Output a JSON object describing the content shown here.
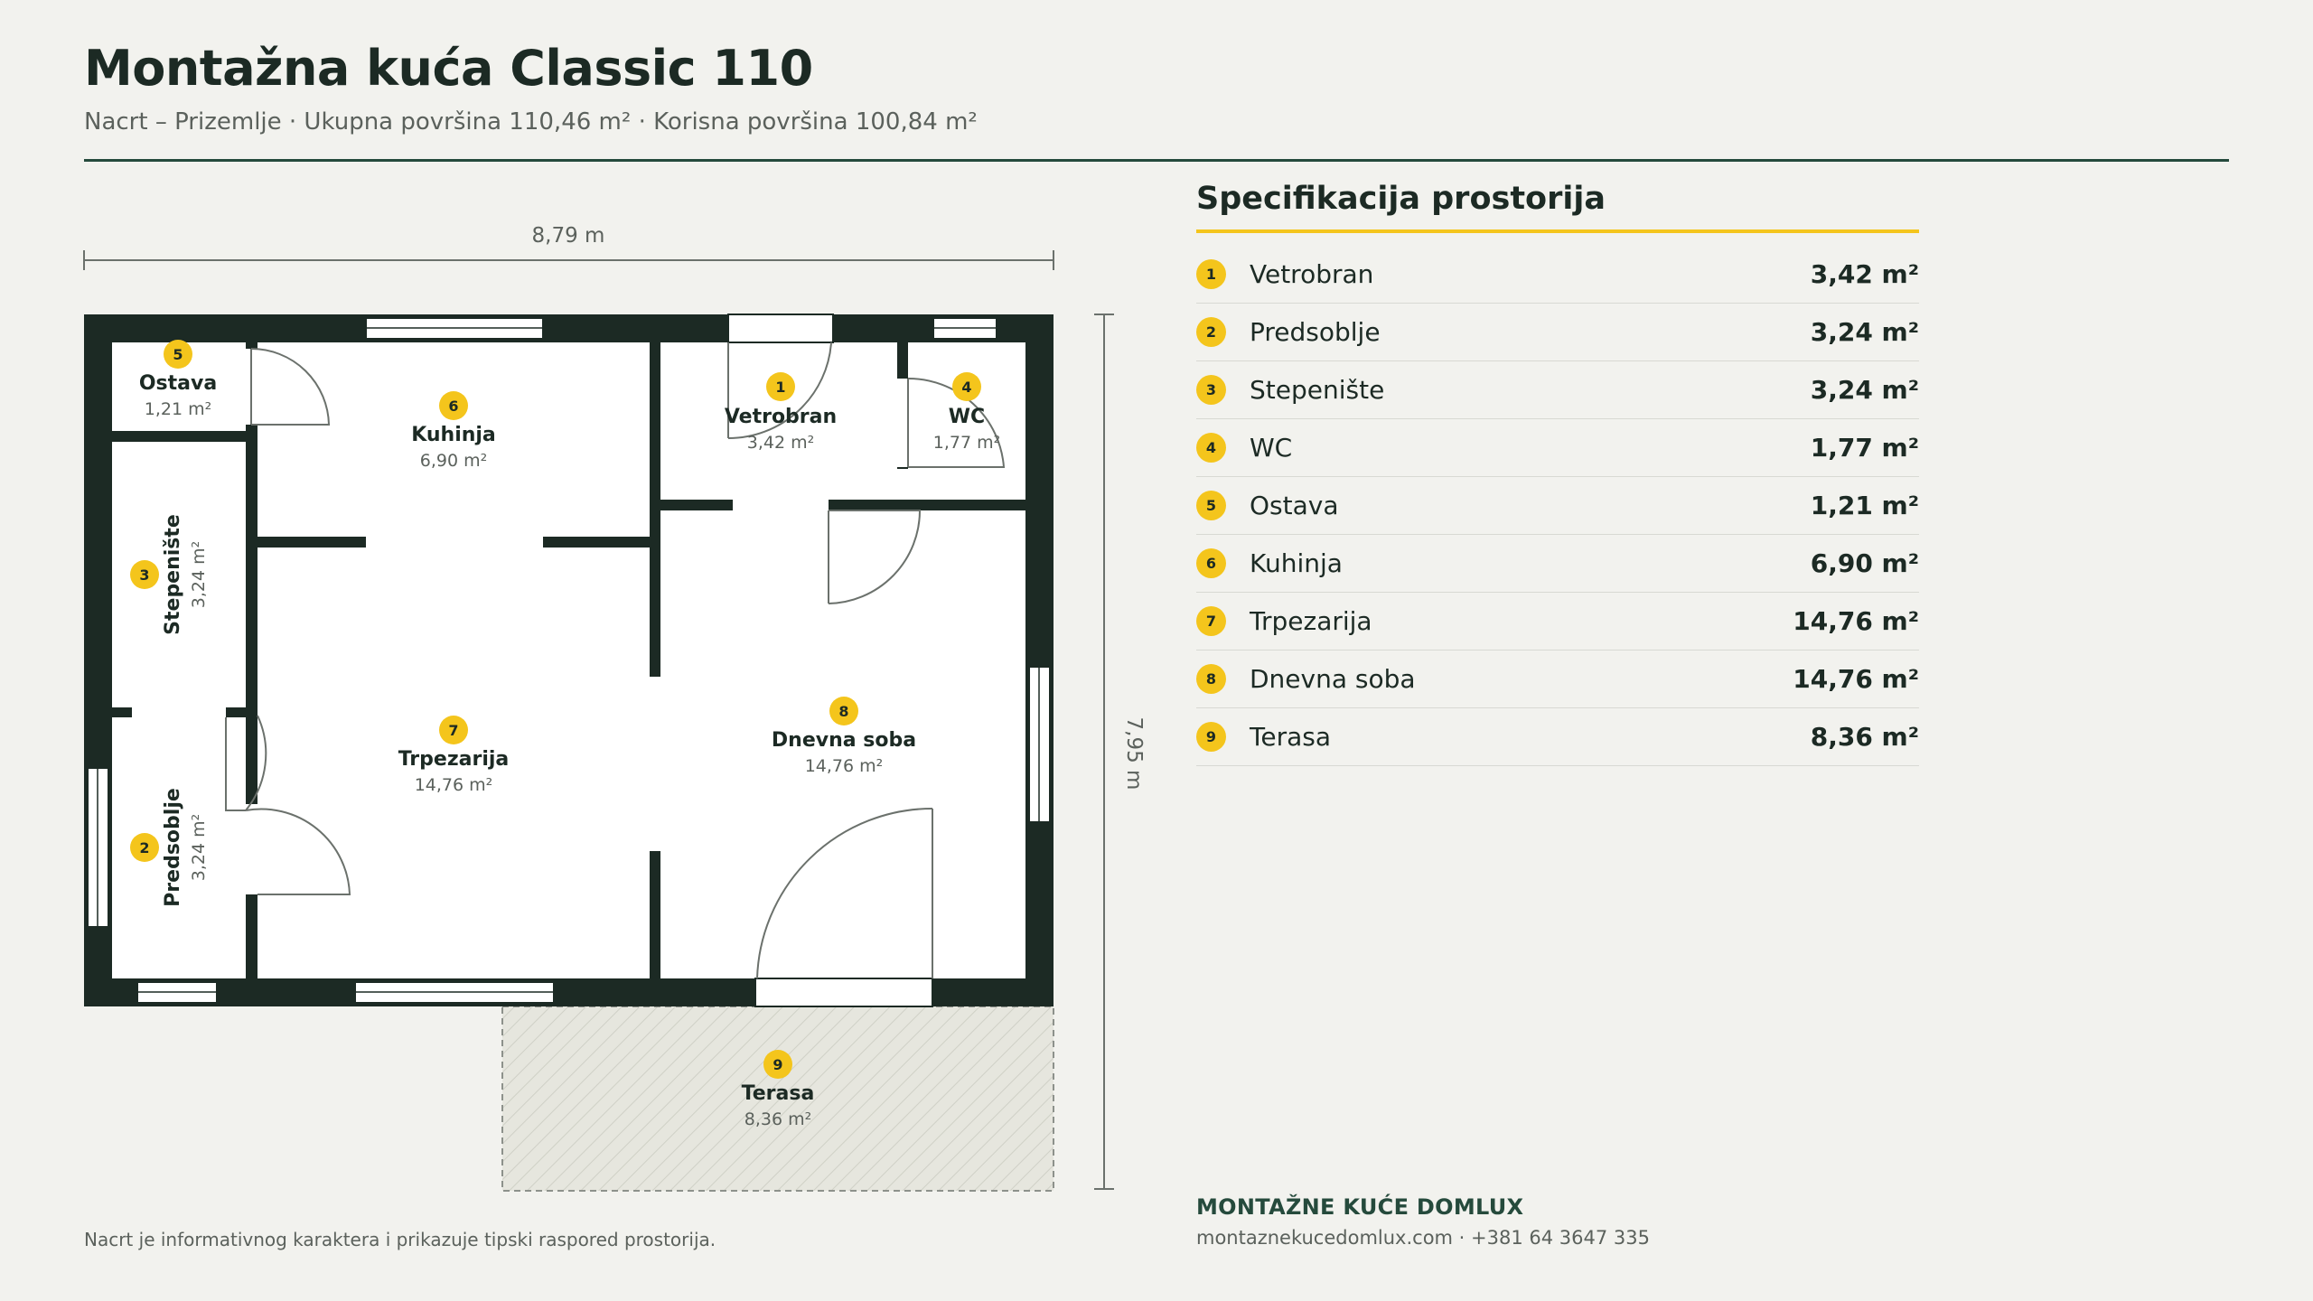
{
  "header": {
    "title": "Montažna kuća Classic 110",
    "subtitle": "Nacrt – Prizemlje · Ukupna površina 110,46 m² · Korisna površina 100,84 m²"
  },
  "plan": {
    "width_label": "8,79 m",
    "depth_label": "7,95 m",
    "rooms": [
      {
        "num": "1",
        "name": "Vetrobran",
        "area": "3,42 m²"
      },
      {
        "num": "2",
        "name": "Predsoblje",
        "area": "3,24 m²"
      },
      {
        "num": "3",
        "name": "Stepenište",
        "area": "3,24 m²"
      },
      {
        "num": "4",
        "name": "WC",
        "area": "1,77 m²"
      },
      {
        "num": "5",
        "name": "Ostava",
        "area": "1,21 m²"
      },
      {
        "num": "6",
        "name": "Kuhinja",
        "area": "6,90 m²"
      },
      {
        "num": "7",
        "name": "Trpezarija",
        "area": "14,76 m²"
      },
      {
        "num": "8",
        "name": "Dnevna soba",
        "area": "14,76 m²"
      },
      {
        "num": "9",
        "name": "Terasa",
        "area": "8,36 m²"
      }
    ]
  },
  "spec": {
    "title": "Specifikacija prostorija",
    "items": [
      {
        "num": "1",
        "name": "Vetrobran",
        "area": "3,42 m²"
      },
      {
        "num": "2",
        "name": "Predsoblje",
        "area": "3,24 m²"
      },
      {
        "num": "3",
        "name": "Stepenište",
        "area": "3,24 m²"
      },
      {
        "num": "4",
        "name": "WC",
        "area": "1,77 m²"
      },
      {
        "num": "5",
        "name": "Ostava",
        "area": "1,21 m²"
      },
      {
        "num": "6",
        "name": "Kuhinja",
        "area": "6,90 m²"
      },
      {
        "num": "7",
        "name": "Trpezarija",
        "area": "14,76 m²"
      },
      {
        "num": "8",
        "name": "Dnevna soba",
        "area": "14,76 m²"
      },
      {
        "num": "9",
        "name": "Terasa",
        "area": "8,36 m²"
      }
    ]
  },
  "footer": {
    "brand": "MONTAŽNE KUĆE DOMLUX",
    "contact": "montaznekucedomlux.com · +381 64 3647 335",
    "note": "Nacrt je informativnog karaktera i prikazuje tipski raspored prostorija."
  },
  "colors": {
    "wall": "#1c2a24",
    "accent": "#f4c51c",
    "rule": "#254a3c",
    "background": "#f2f2ee"
  }
}
